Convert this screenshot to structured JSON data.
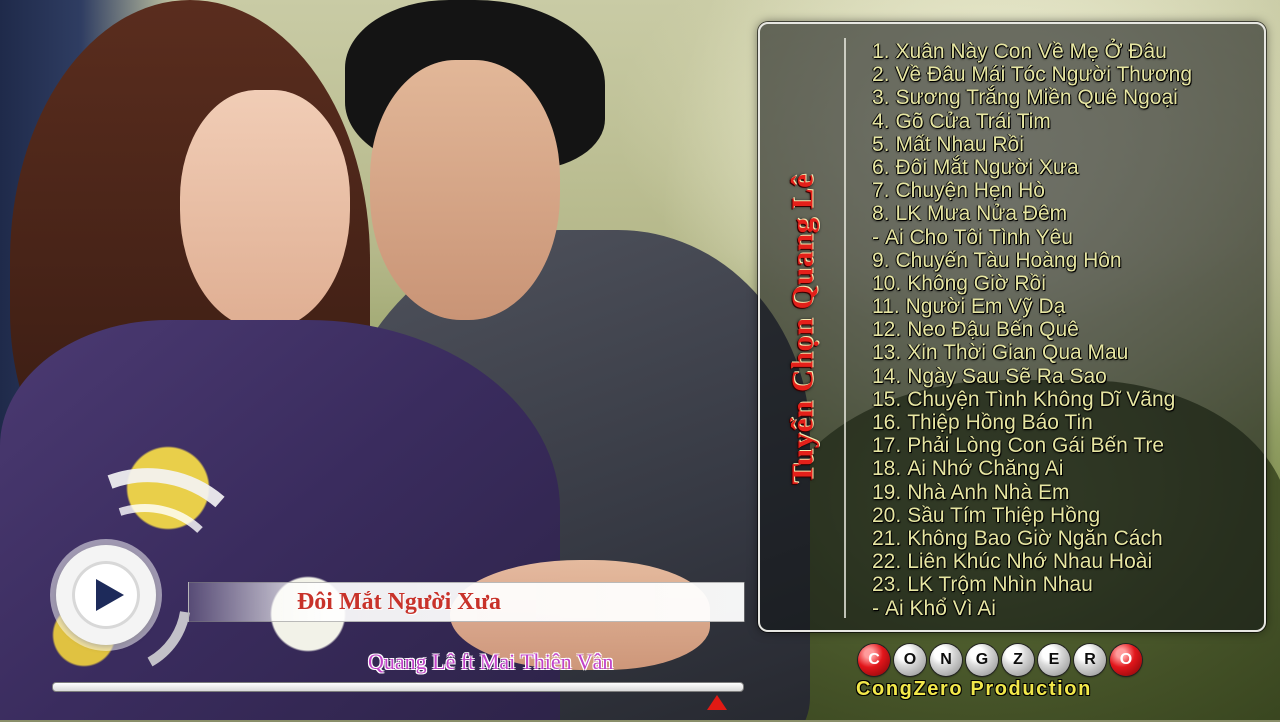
{
  "panel": {
    "title": "Tuyển Chọn Quang Lê",
    "tracks": [
      {
        "num": "1.",
        "title": "Xuân Này Con Về Mẹ Ở Đâu"
      },
      {
        "num": "2.",
        "title": "Về Đâu Mái Tóc Người Thương"
      },
      {
        "num": "3.",
        "title": "Sương Trắng Miền Quê Ngoại"
      },
      {
        "num": "4.",
        "title": "Gõ Cửa Trái Tim"
      },
      {
        "num": "5.",
        "title": "Mất Nhau Rồi"
      },
      {
        "num": "6.",
        "title": "Đôi Mắt Người Xưa"
      },
      {
        "num": "7.",
        "title": "Chuyện Hẹn Hò"
      },
      {
        "num": "8.",
        "title": "LK Mưa Nửa Đêm"
      },
      {
        "num": "-",
        "title": "Ai Cho Tôi Tình Yêu"
      },
      {
        "num": "9.",
        "title": "Chuyến Tàu Hoàng Hôn"
      },
      {
        "num": "10.",
        "title": "Không Giờ Rồi"
      },
      {
        "num": "11.",
        "title": "Người Em Vỹ Dạ"
      },
      {
        "num": "12.",
        "title": "Neo Đậu Bến Quê"
      },
      {
        "num": "13.",
        "title": "Xin Thời Gian Qua Mau"
      },
      {
        "num": "14.",
        "title": "Ngày Sau Sẽ Ra Sao"
      },
      {
        "num": "15.",
        "title": "Chuyện Tình Không Dĩ Vãng"
      },
      {
        "num": "16.",
        "title": "Thiệp Hồng Báo Tin"
      },
      {
        "num": "17.",
        "title": "Phải Lòng Con Gái Bến Tre"
      },
      {
        "num": "18.",
        "title": "Ai Nhớ Chăng Ai"
      },
      {
        "num": "19.",
        "title": "Nhà Anh Nhà Em"
      },
      {
        "num": "20.",
        "title": "Sầu Tím Thiệp Hồng"
      },
      {
        "num": "21.",
        "title": "Không Bao Giờ Ngăn Cách"
      },
      {
        "num": "22.",
        "title": "Liên Khúc Nhớ Nhau Hoài"
      },
      {
        "num": "23.",
        "title": "LK Trộm Nhìn Nhau"
      },
      {
        "num": "-",
        "title": "Ai Khổ Vì Ai"
      }
    ]
  },
  "player": {
    "now_playing": "Đôi Mắt Người Xưa",
    "artist": "Quang Lê ft Mai Thiên Vân",
    "progress": 0
  },
  "logo": {
    "letters": [
      "C",
      "O",
      "N",
      "G",
      "Z",
      "E",
      "R",
      "O"
    ],
    "caption": "CongZero Production"
  },
  "colors": {
    "title_red": "#e4201a",
    "track_text": "#e7e6a2",
    "now_playing_red": "#c8322a",
    "artist_purple": "#c243c9",
    "logo_yellow": "#f2e84a",
    "progress_marker": "#e11a14"
  }
}
